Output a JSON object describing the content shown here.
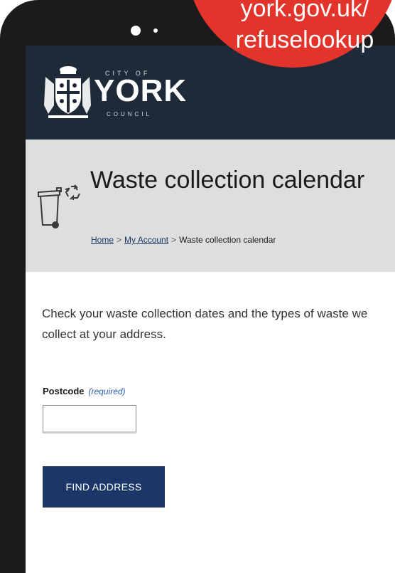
{
  "logo": {
    "city_of": "CITY OF",
    "york": "YORK",
    "council": "COUNCIL"
  },
  "page": {
    "title": "Waste collection calendar",
    "breadcrumb": {
      "home": "Home",
      "separator": ">",
      "my_account": "My Account",
      "current": "Waste collection calendar"
    }
  },
  "intro_text": "Check your waste collection dates and the types of waste we collect at your address.",
  "form": {
    "postcode_label": "Postcode",
    "postcode_required": "(required)",
    "postcode_value": "",
    "find_button_label": "FIND ADDRESS"
  },
  "badge": {
    "url_line1": "york.gov.uk/",
    "url_line2": "refuselookup"
  },
  "colors": {
    "header_bg": "#1f2a38",
    "hero_bg": "#dcdfdd",
    "button_bg": "#1c3767",
    "badge_bg": "#e3342b",
    "phone_frame": "#1b1b1d"
  },
  "icons": [
    "coat-of-arms-icon",
    "wheelie-bin-icon",
    "recycle-icon"
  ]
}
